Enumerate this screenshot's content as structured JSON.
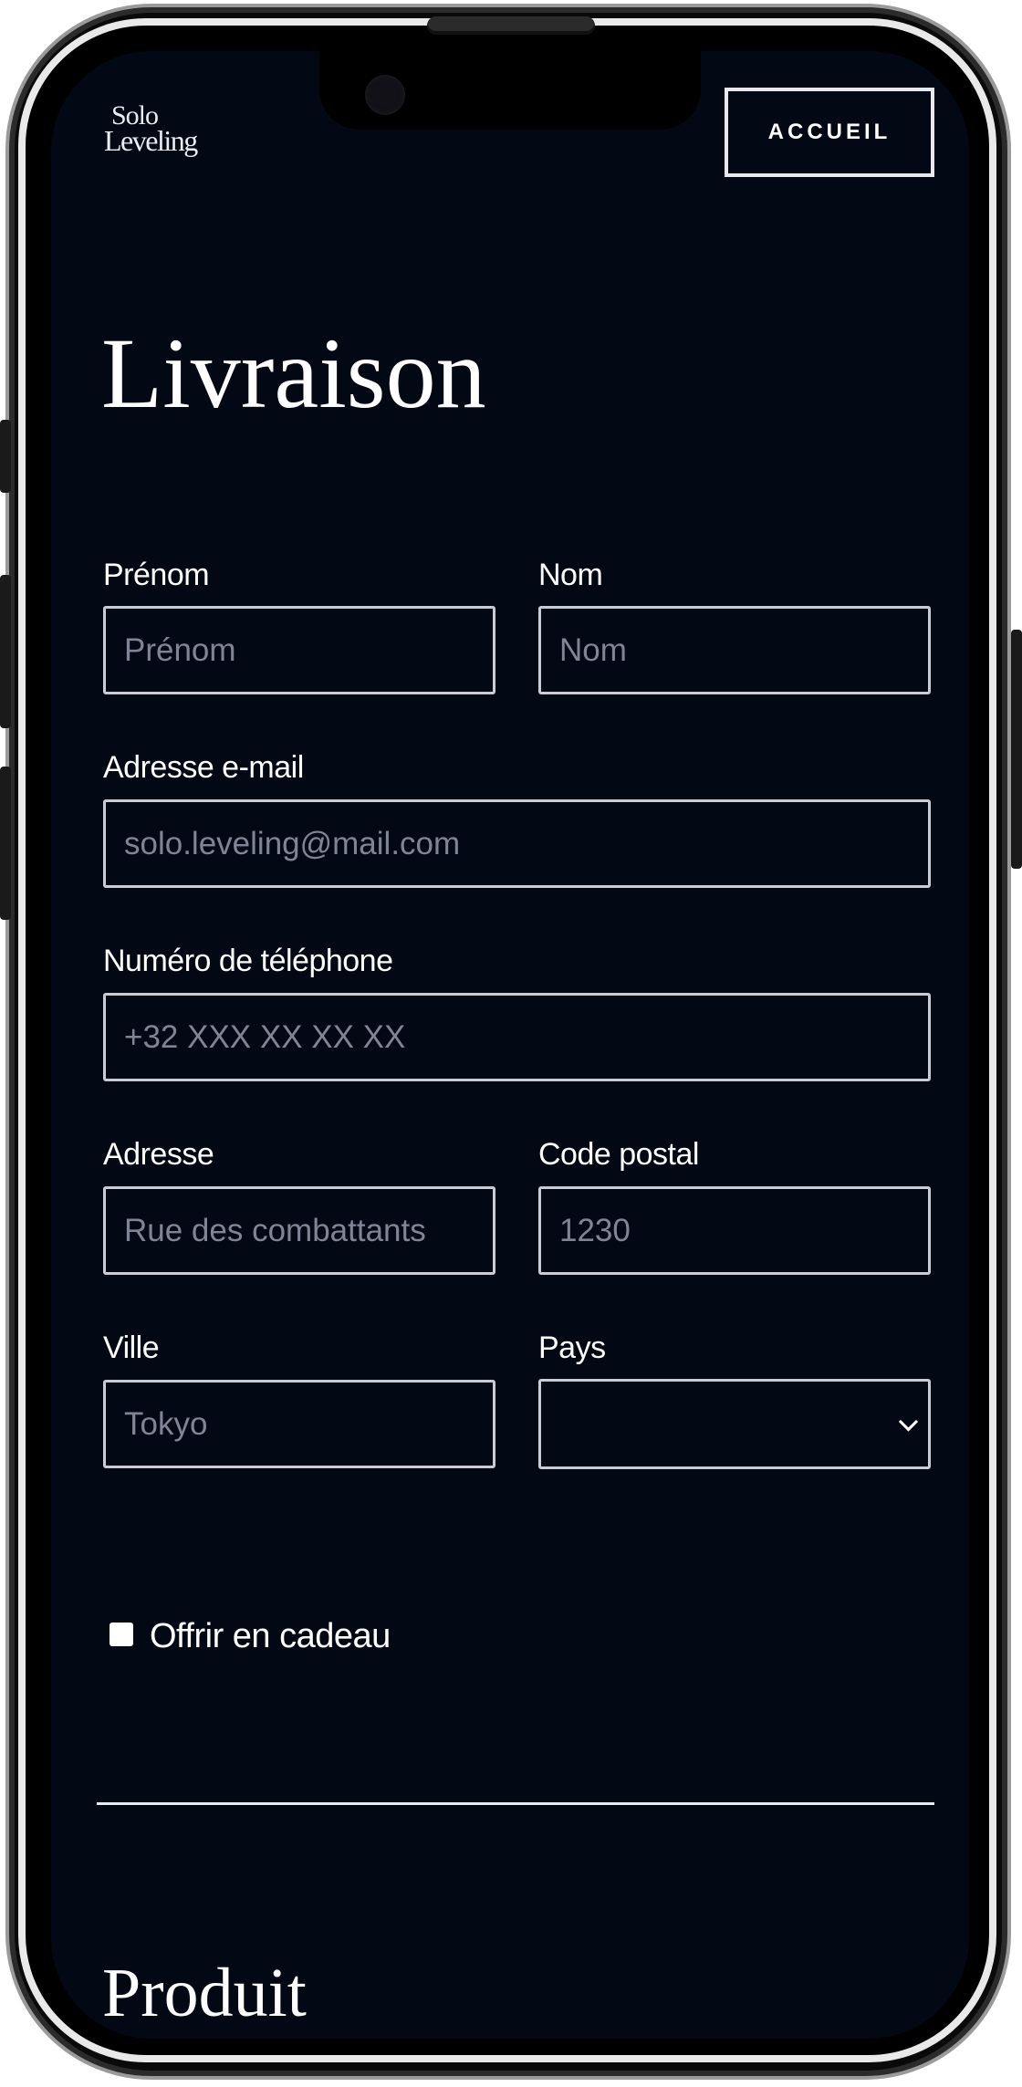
{
  "header": {
    "logo_line1": "Solo",
    "logo_line2": "Leveling",
    "home_button": "ACCUEIL"
  },
  "shipping": {
    "title": "Livraison",
    "first_name": {
      "label": "Prénom",
      "placeholder": "Prénom"
    },
    "last_name": {
      "label": "Nom",
      "placeholder": "Nom"
    },
    "email": {
      "label": "Adresse e-mail",
      "placeholder": "solo.leveling@mail.com"
    },
    "phone": {
      "label": "Numéro de téléphone",
      "placeholder": "+32 XXX XX XX XX"
    },
    "address": {
      "label": "Adresse",
      "placeholder": "Rue des combattants"
    },
    "postal_code": {
      "label": "Code postal",
      "placeholder": "1230"
    },
    "city": {
      "label": "Ville",
      "placeholder": "Tokyo"
    },
    "country": {
      "label": "Pays",
      "value": ""
    },
    "gift_checkbox": {
      "label": "Offrir en cadeau",
      "checked": false
    }
  },
  "product": {
    "title": "Produit"
  },
  "colors": {
    "background": "#030815",
    "text": "#ffffff",
    "placeholder": "#7f8594",
    "border": "#c9ccd4"
  },
  "icons": {
    "select_arrow": "chevron-down-icon"
  }
}
